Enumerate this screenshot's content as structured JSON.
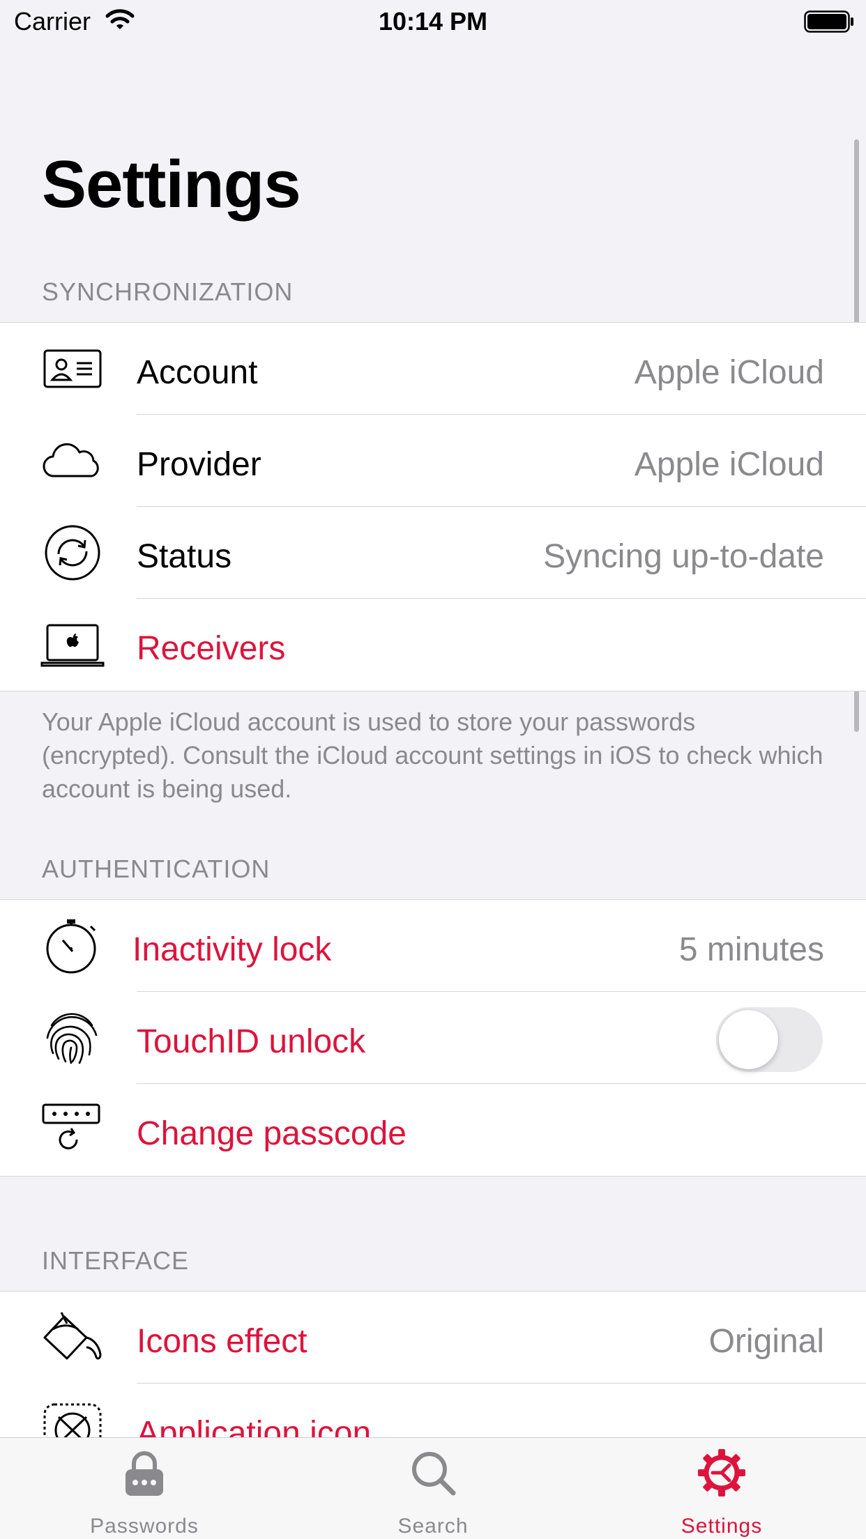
{
  "status_bar": {
    "carrier": "Carrier",
    "time": "10:14 PM"
  },
  "page": {
    "title": "Settings"
  },
  "sync": {
    "header": "SYNCHRONIZATION",
    "rows": [
      {
        "label": "Account",
        "value": "Apple iCloud",
        "icon": "id-card-icon"
      },
      {
        "label": "Provider",
        "value": "Apple iCloud",
        "icon": "cloud-icon"
      },
      {
        "label": "Status",
        "value": "Syncing up-to-date",
        "icon": "sync-icon"
      },
      {
        "label": "Receivers",
        "icon": "laptop-icon"
      }
    ],
    "footer": "Your Apple iCloud account is used to store your passwords (encrypted). Consult the iCloud account settings in iOS to check which account is being used."
  },
  "auth": {
    "header": "AUTHENTICATION",
    "rows": [
      {
        "label": "Inactivity lock",
        "value": "5 minutes",
        "icon": "stopwatch-icon"
      },
      {
        "label": "TouchID unlock",
        "toggle_on": false,
        "icon": "fingerprint-icon"
      },
      {
        "label": "Change passcode",
        "icon": "passcode-icon"
      }
    ]
  },
  "interface": {
    "header": "INTERFACE",
    "rows": [
      {
        "label": "Icons effect",
        "value": "Original",
        "icon": "paint-bucket-icon"
      },
      {
        "label": "Application icon",
        "icon": "app-icon-grid-icon"
      }
    ]
  },
  "tabs": [
    {
      "label": "Passwords",
      "icon": "lock-icon",
      "active": false
    },
    {
      "label": "Search",
      "icon": "search-icon",
      "active": false
    },
    {
      "label": "Settings",
      "icon": "gear-icon",
      "active": true
    }
  ],
  "colors": {
    "accent": "#dc143c",
    "secondary_text": "#8a8a8e",
    "background": "#f2f2f7"
  }
}
